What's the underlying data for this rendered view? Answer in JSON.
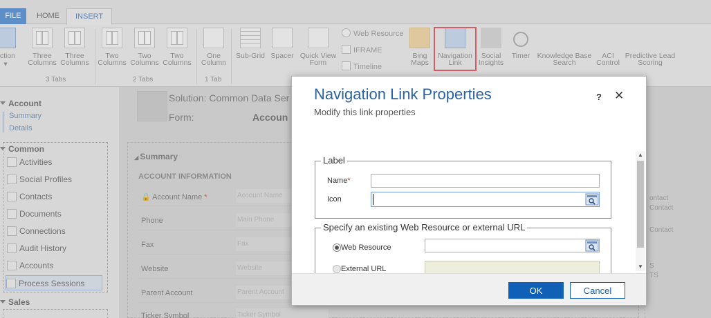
{
  "ribbon": {
    "tabs": {
      "file": "FILE",
      "home": "HOME",
      "insert": "INSERT"
    },
    "section_btn": {
      "line1": "ection",
      "chevron": "▾"
    },
    "three_col_1": {
      "line1": "Three",
      "line2": "Columns"
    },
    "three_col_2": {
      "line1": "Three",
      "line2": "Columns"
    },
    "two_col_1": {
      "line1": "Two",
      "line2": "Columns"
    },
    "two_col_2": {
      "line1": "Two",
      "line2": "Columns"
    },
    "two_col_3": {
      "line1": "Two",
      "line2": "Columns"
    },
    "one_col": {
      "line1": "One",
      "line2": "Column"
    },
    "groups": {
      "three_tabs": "3 Tabs",
      "two_tabs": "2 Tabs",
      "one_tab": "1 Tab"
    },
    "subgrid": "Sub-Grid",
    "spacer": "Spacer",
    "quickview": {
      "line1": "Quick View",
      "line2": "Form"
    },
    "web_resource": "Web Resource",
    "iframe": "IFRAME",
    "timeline": "Timeline",
    "bing": {
      "line1": "Bing",
      "line2": "Maps"
    },
    "navlink": {
      "line1": "Navigation",
      "line2": "Link"
    },
    "social": {
      "line1": "Social",
      "line2": "Insights"
    },
    "timer": "Timer",
    "kbsearch": {
      "line1": "Knowledge Base",
      "line2": "Search"
    },
    "aci": {
      "line1": "ACI",
      "line2": "Control"
    },
    "predictive": {
      "line1": "Predictive Lead",
      "line2": "Scoring"
    }
  },
  "leftnav": {
    "account_header": "Account",
    "account_links": [
      "Summary",
      "Details"
    ],
    "common_header": "Common",
    "common_items": [
      "Activities",
      "Social Profiles",
      "Contacts",
      "Documents",
      "Connections",
      "Audit History",
      "Accounts",
      "Process Sessions"
    ],
    "sales_header": "Sales"
  },
  "form": {
    "solution_text": "Solution: Common Data Ser",
    "form_label": "Form:",
    "form_value": "Accoun",
    "section_title": "Summary",
    "subsection_title": "ACCOUNT INFORMATION",
    "fields": [
      {
        "label": "Account Name",
        "placeholder": "Account Name"
      },
      {
        "label": "Phone",
        "placeholder": "Main Phone"
      },
      {
        "label": "Fax",
        "placeholder": "Fax"
      },
      {
        "label": "Website",
        "placeholder": "Website"
      },
      {
        "label": "Parent Account",
        "placeholder": "Parent Account"
      },
      {
        "label": "Ticker Symbol",
        "placeholder": "Ticker Symbol"
      }
    ],
    "right_texts": [
      "ontact",
      "Contact",
      "Contact",
      "S",
      "TS"
    ]
  },
  "dialog": {
    "title": "Navigation Link Properties",
    "subtitle": "Modify this link properties",
    "help": "?",
    "close": "✕",
    "label_group": "Label",
    "name_label": "Name",
    "name_required": "*",
    "name_value": "",
    "icon_label": "Icon",
    "icon_value": "",
    "url_group": "Specify an existing Web Resource or external URL",
    "web_resource_label": "Web Resource",
    "web_resource_value": "",
    "external_url_label": "External URL",
    "external_url_value": "",
    "ok": "OK",
    "cancel": "Cancel"
  },
  "colors": {
    "accent": "#1160b7",
    "title": "#2a62a8",
    "highlight": "#d83a49"
  },
  "icons": [
    "search-lookup-icon",
    "close-icon",
    "help-icon",
    "lock-icon",
    "navigation-link-icon"
  ]
}
